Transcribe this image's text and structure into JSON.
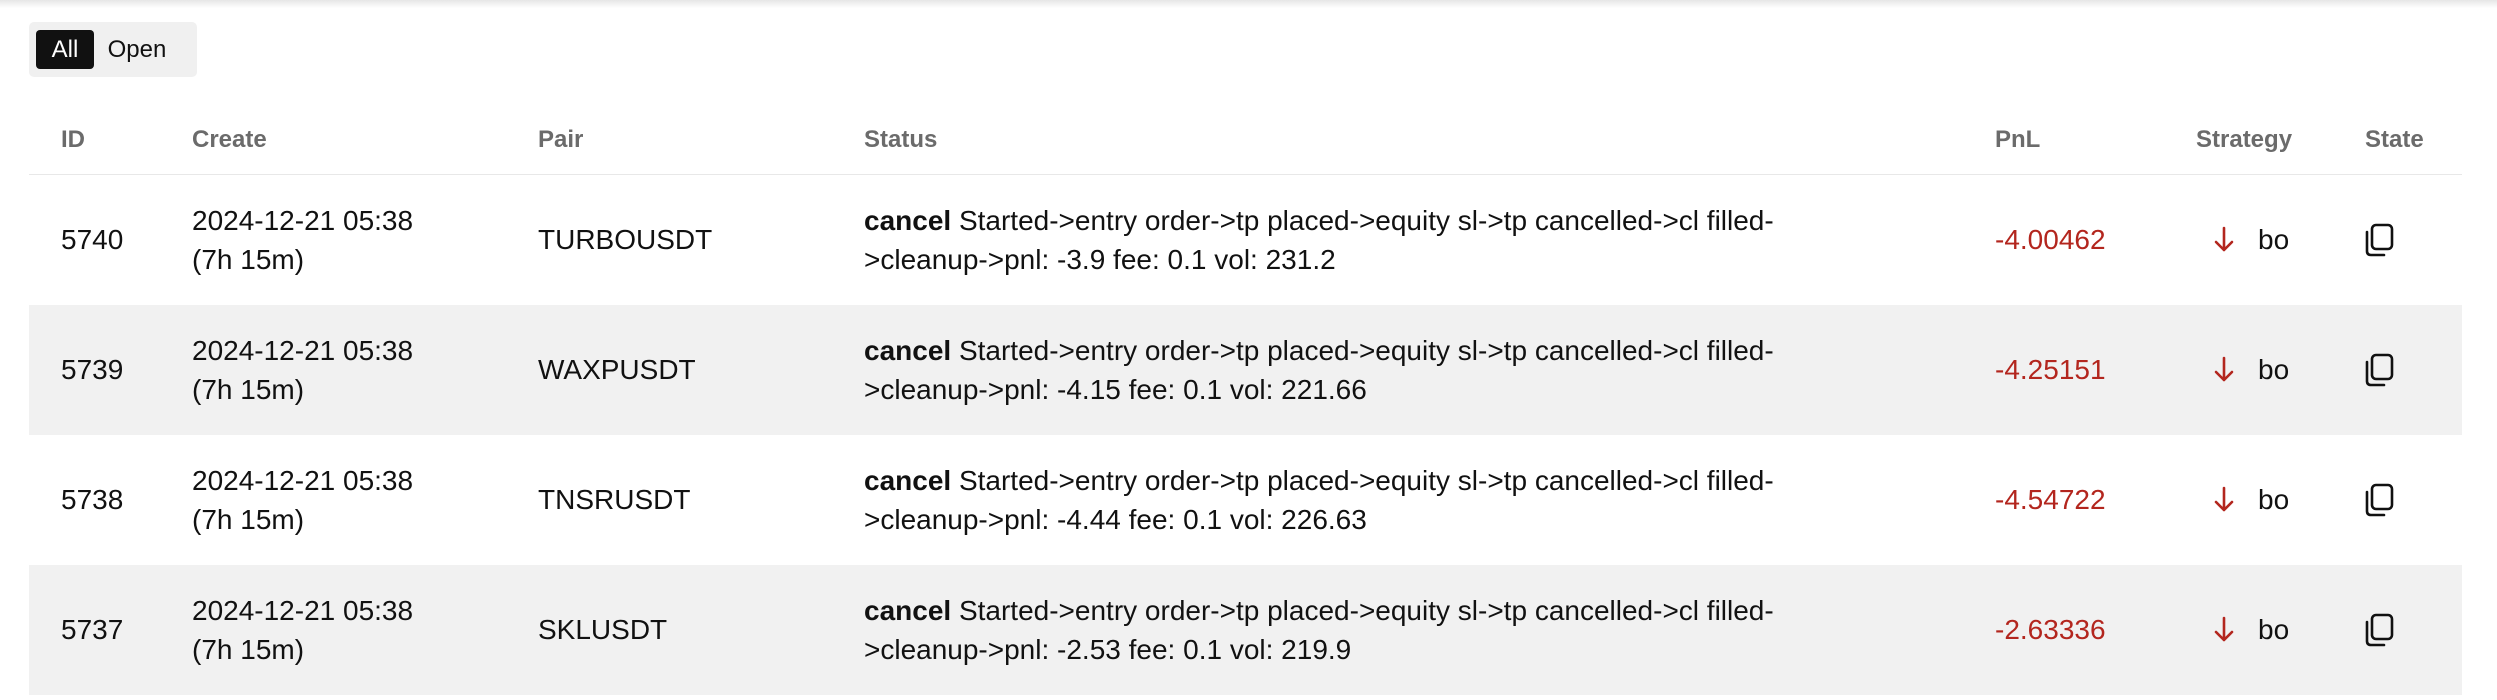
{
  "filters": {
    "all_label": "All",
    "open_label": "Open",
    "selected": "All"
  },
  "table": {
    "headers": {
      "id": "ID",
      "create": "Create",
      "pair": "Pair",
      "status": "Status",
      "pnl": "PnL",
      "strategy": "Strategy",
      "state": "State"
    },
    "rows": [
      {
        "id": "5740",
        "create_date": "2024-12-21 05:38",
        "create_age": "(7h 15m)",
        "pair": "TURBOUSDT",
        "status_keyword": "cancel",
        "status_line1": "Started->entry order->tp placed->equity sl->tp cancelled->cl filled-",
        "status_line2": ">cleanup->pnl: -3.9 fee: 0.1 vol: 231.2",
        "pnl": "-4.00462",
        "strategy_direction": "down",
        "strategy_label": "bo",
        "state_icon": "copy-icon"
      },
      {
        "id": "5739",
        "create_date": "2024-12-21 05:38",
        "create_age": "(7h 15m)",
        "pair": "WAXPUSDT",
        "status_keyword": "cancel",
        "status_line1": "Started->entry order->tp placed->equity sl->tp cancelled->cl filled-",
        "status_line2": ">cleanup->pnl: -4.15 fee: 0.1 vol: 221.66",
        "pnl": "-4.25151",
        "strategy_direction": "down",
        "strategy_label": "bo",
        "state_icon": "copy-icon"
      },
      {
        "id": "5738",
        "create_date": "2024-12-21 05:38",
        "create_age": "(7h 15m)",
        "pair": "TNSRUSDT",
        "status_keyword": "cancel",
        "status_line1": "Started->entry order->tp placed->equity sl->tp cancelled->cl filled-",
        "status_line2": ">cleanup->pnl: -4.44 fee: 0.1 vol: 226.63",
        "pnl": "-4.54722",
        "strategy_direction": "down",
        "strategy_label": "bo",
        "state_icon": "copy-icon"
      },
      {
        "id": "5737",
        "create_date": "2024-12-21 05:38",
        "create_age": "(7h 15m)",
        "pair": "SKLUSDT",
        "status_keyword": "cancel",
        "status_line1": "Started->entry order->tp placed->equity sl->tp cancelled->cl filled-",
        "status_line2": ">cleanup->pnl: -2.53 fee: 0.1 vol: 219.9",
        "pnl": "-2.63336",
        "strategy_direction": "down",
        "strategy_label": "bo",
        "state_icon": "copy-icon"
      }
    ]
  },
  "colors": {
    "negative": "#b3261e",
    "header_text": "#6b6b6b",
    "row_alt_bg": "#f1f1f1",
    "active_filter_bg": "#111111"
  }
}
